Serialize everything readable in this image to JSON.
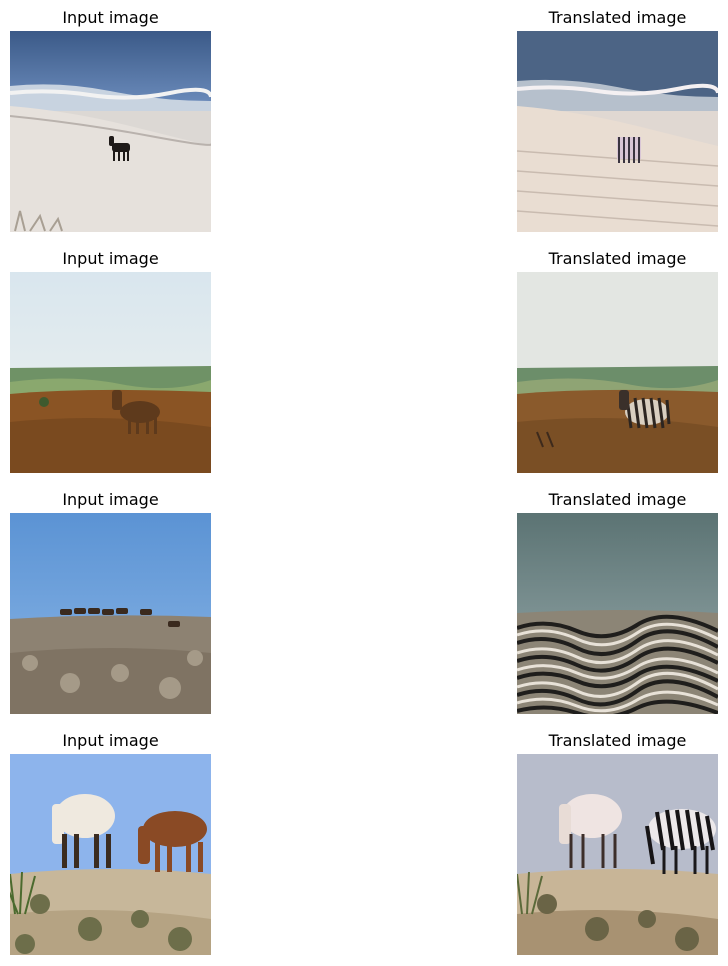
{
  "rows": [
    {
      "input": {
        "title": "Input image",
        "scene": "beach with horse"
      },
      "output": {
        "title": "Translated image",
        "scene": "beach with zebra-textured horse"
      }
    },
    {
      "input": {
        "title": "Input image",
        "scene": "hillside with brown horse"
      },
      "output": {
        "title": "Translated image",
        "scene": "hillside with striped horse"
      }
    },
    {
      "input": {
        "title": "Input image",
        "scene": "herd of horses on scrubland"
      },
      "output": {
        "title": "Translated image",
        "scene": "striped scrubland"
      }
    },
    {
      "input": {
        "title": "Input image",
        "scene": "two horses grazing in desert"
      },
      "output": {
        "title": "Translated image",
        "scene": "two zebra-textured horses grazing"
      }
    }
  ]
}
